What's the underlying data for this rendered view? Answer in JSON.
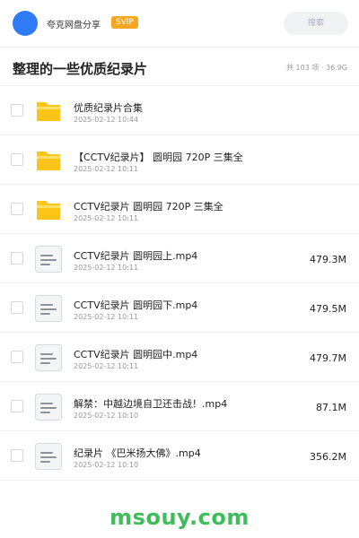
{
  "header": {
    "app_name": "夸克网盘分享",
    "badge": "SVIP",
    "search_placeholder": "搜索"
  },
  "folder": {
    "title": "整理的一些优质纪录片",
    "meta": "共 103 项 · 36.9G"
  },
  "items": [
    {
      "type": "folder",
      "icon": "folder-icon",
      "name": "优质纪录片合集",
      "date": "2025-02-12 10:44",
      "size": ""
    },
    {
      "type": "folder",
      "icon": "folder-icon",
      "name": "【CCTV纪录片】 圆明园 720P 三集全",
      "date": "2025-02-12 10:11",
      "size": ""
    },
    {
      "type": "folder",
      "icon": "folder-icon",
      "name": "CCTV纪录片  圆明园  720P 三集全",
      "date": "2025-02-12 10:11",
      "size": ""
    },
    {
      "type": "file",
      "icon": "video-file-icon",
      "name": "CCTV纪录片 圆明园上.mp4",
      "date": "2025-02-12 10:11",
      "size": "479.3M"
    },
    {
      "type": "file",
      "icon": "video-file-icon",
      "name": "CCTV纪录片 圆明园下.mp4",
      "date": "2025-02-12 10:11",
      "size": "479.5M"
    },
    {
      "type": "file",
      "icon": "video-file-icon",
      "name": "CCTV纪录片 圆明园中.mp4",
      "date": "2025-02-12 10:11",
      "size": "479.7M"
    },
    {
      "type": "file",
      "icon": "video-file-icon",
      "name": "解禁：中越边境自卫还击战！.mp4",
      "date": "2025-02-12 10:10",
      "size": "87.1M"
    },
    {
      "type": "file",
      "icon": "video-file-icon",
      "name": "纪录片 《巴米扬大佛》.mp4",
      "date": "2025-02-12 10:10",
      "size": "356.2M"
    }
  ],
  "footer": {
    "brand": "msouy.com"
  },
  "colors": {
    "avatar": "#2f7bf5",
    "svip": "#f5a623",
    "folder": "#ffc61a",
    "brand": "#3dbe5a"
  }
}
